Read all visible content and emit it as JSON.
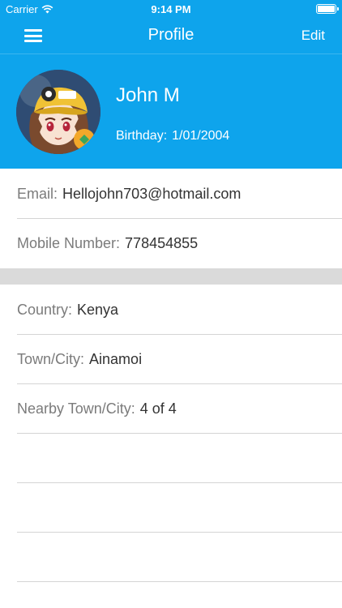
{
  "status_bar": {
    "carrier": "Carrier",
    "time": "9:14 PM"
  },
  "nav": {
    "title": "Profile",
    "edit_label": "Edit"
  },
  "profile": {
    "name": "John M",
    "birthday_label": "Birthday:",
    "birthday_value": "1/01/2004"
  },
  "contact": {
    "email_label": "Email:",
    "email_value": "Hellojohn703@hotmail.com",
    "mobile_label": "Mobile Number:",
    "mobile_value": "778454855"
  },
  "location": {
    "country_label": "Country:",
    "country_value": "Kenya",
    "town_label": "Town/City:",
    "town_value": "Ainamoi",
    "nearby_label": "Nearby Town/City:",
    "nearby_value": "4 of 4"
  },
  "colors": {
    "primary": "#0ea4ec",
    "divider": "#d4d4d4",
    "band": "#dadada"
  },
  "icons": [
    "wifi-icon",
    "battery-icon",
    "menu-icon",
    "avatar"
  ]
}
